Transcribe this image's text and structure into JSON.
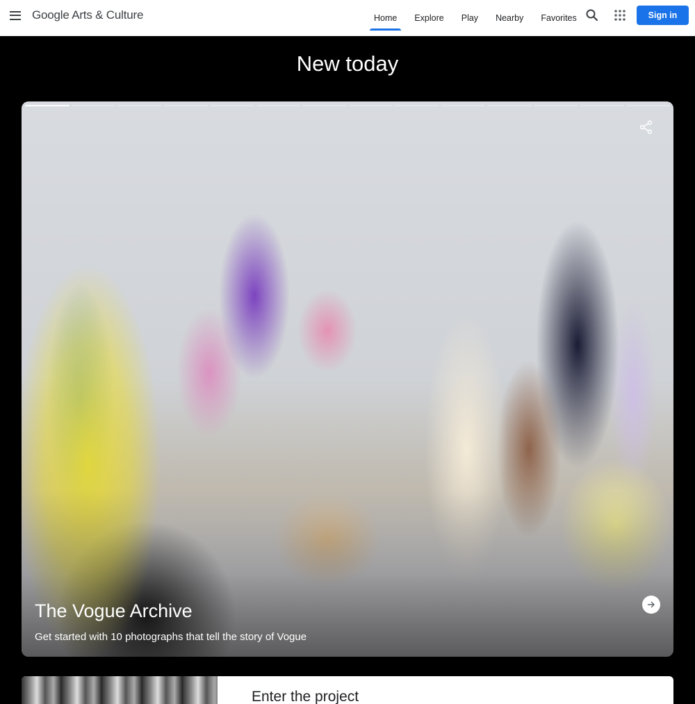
{
  "header": {
    "menu_icon": "hamburger-menu-icon",
    "logo_text": "Google Arts & Culture",
    "nav": [
      {
        "label": "Home",
        "active": true
      },
      {
        "label": "Explore",
        "active": false
      },
      {
        "label": "Play",
        "active": false
      },
      {
        "label": "Nearby",
        "active": false
      },
      {
        "label": "Favorites",
        "active": false
      }
    ],
    "search_icon": "search-icon",
    "apps_icon": "apps-grid-icon",
    "signin_label": "Sign in",
    "accent_color": "#1a73e8"
  },
  "section": {
    "title": "New today"
  },
  "hero": {
    "title": "The Vogue Archive",
    "subtitle": "Get started with 10 photographs that tell the story of Vogue",
    "story_segments": 14,
    "active_segment": 1,
    "share_icon": "share-icon",
    "next_icon": "arrow-right-icon"
  },
  "next_card": {
    "title_partial": "Enter the project"
  }
}
